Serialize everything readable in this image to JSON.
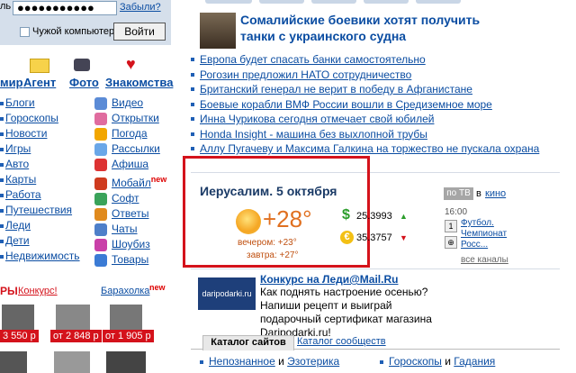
{
  "login": {
    "label_fragment": "ль",
    "password_mask": "●●●●●●●●●●●",
    "forgot": "Забыли?",
    "foreign_pc": "Чужой компьютер",
    "submit": "Войти"
  },
  "icons_row": [
    {
      "label": "мир"
    },
    {
      "label": "Агент"
    },
    {
      "label": "Фото"
    },
    {
      "label": "Знакомства"
    }
  ],
  "left_services": [
    "Блоги",
    "Гороскопы",
    "Новости",
    "Игры",
    "Авто",
    "Карты",
    "Работа",
    "Путешествия",
    "Леди",
    "Дети",
    "Недвижимость"
  ],
  "mid_services": [
    {
      "label": "Видео",
      "color": "#5b8bd6"
    },
    {
      "label": "Открытки",
      "color": "#e06c9f"
    },
    {
      "label": "Погода",
      "color": "#f2a600"
    },
    {
      "label": "Рассылки",
      "color": "#6aa7e8"
    },
    {
      "label": "Афиша",
      "color": "#d33",
      "new": ""
    },
    {
      "label": "Мобайл",
      "color": "#cf3b1f",
      "new": "new"
    },
    {
      "label": "Софт",
      "color": "#3aa35a"
    },
    {
      "label": "Ответы",
      "color": "#e08a1e"
    },
    {
      "label": "Чаты",
      "color": "#4e7fc9"
    },
    {
      "label": "Шоубиз",
      "color": "#c940a8"
    },
    {
      "label": "Товары",
      "color": "#3b7bd5"
    }
  ],
  "new_badge": "new",
  "shop": {
    "title_fragment": "РЫ",
    "contest": "Конкурс!",
    "flea": "Барахолка",
    "flea_new": "new",
    "prices": [
      "3 550 р",
      "от 2 848 р",
      "от 1 905 р"
    ]
  },
  "news": {
    "headline": "Сомалийские боевики хотят получить танки с украинского судна",
    "items": [
      "Европа будет спасать банки самостоятельно",
      "Рогозин предложил НАТО сотрудничество",
      "Британский генерал не верит в победу в Афганистане",
      "Боевые корабли ВМФ России вошли в Средиземное море",
      "Инна Чурикова сегодня отмечает свой юбилей",
      "Honda Insight - машина без выхлопной трубы",
      "Аллу Пугачеву и Максима Галкина на торжество не пускала охрана"
    ]
  },
  "weather": {
    "city": "Иерусалим. 5 октября",
    "temp": "+28°",
    "evening": "вечером: +23°",
    "tomorrow": "завтра: +27°",
    "usd": "25.3993",
    "eur": "35.3757",
    "usd_trend": "▲",
    "eur_trend": "▼"
  },
  "tv": {
    "button": "по ТВ",
    "in": "в",
    "cinema": "кино",
    "time": "16:00",
    "show": "Футбол. Чемпионат Росс...",
    "all": "все каналы"
  },
  "promo": {
    "logo": "daripodarki.ru",
    "title": "Конкурс на Леди@Mail.Ru",
    "text": "Как поднять настроение осенью? Напиши рецепт и выиграй подарочный сертификат магазина Daripodarki.ru!"
  },
  "catalog": {
    "tab1": "Каталог сайтов",
    "tab2": "Каталог сообществ",
    "row": [
      {
        "a": "Непознанное",
        "b": "Эзотерика"
      },
      {
        "a": "Гороскопы",
        "b": "Гадания"
      }
    ],
    "and": "и"
  },
  "colors": {
    "link": "#0b4da2",
    "accent_red": "#d4121b",
    "weather_orange": "#e07020"
  }
}
